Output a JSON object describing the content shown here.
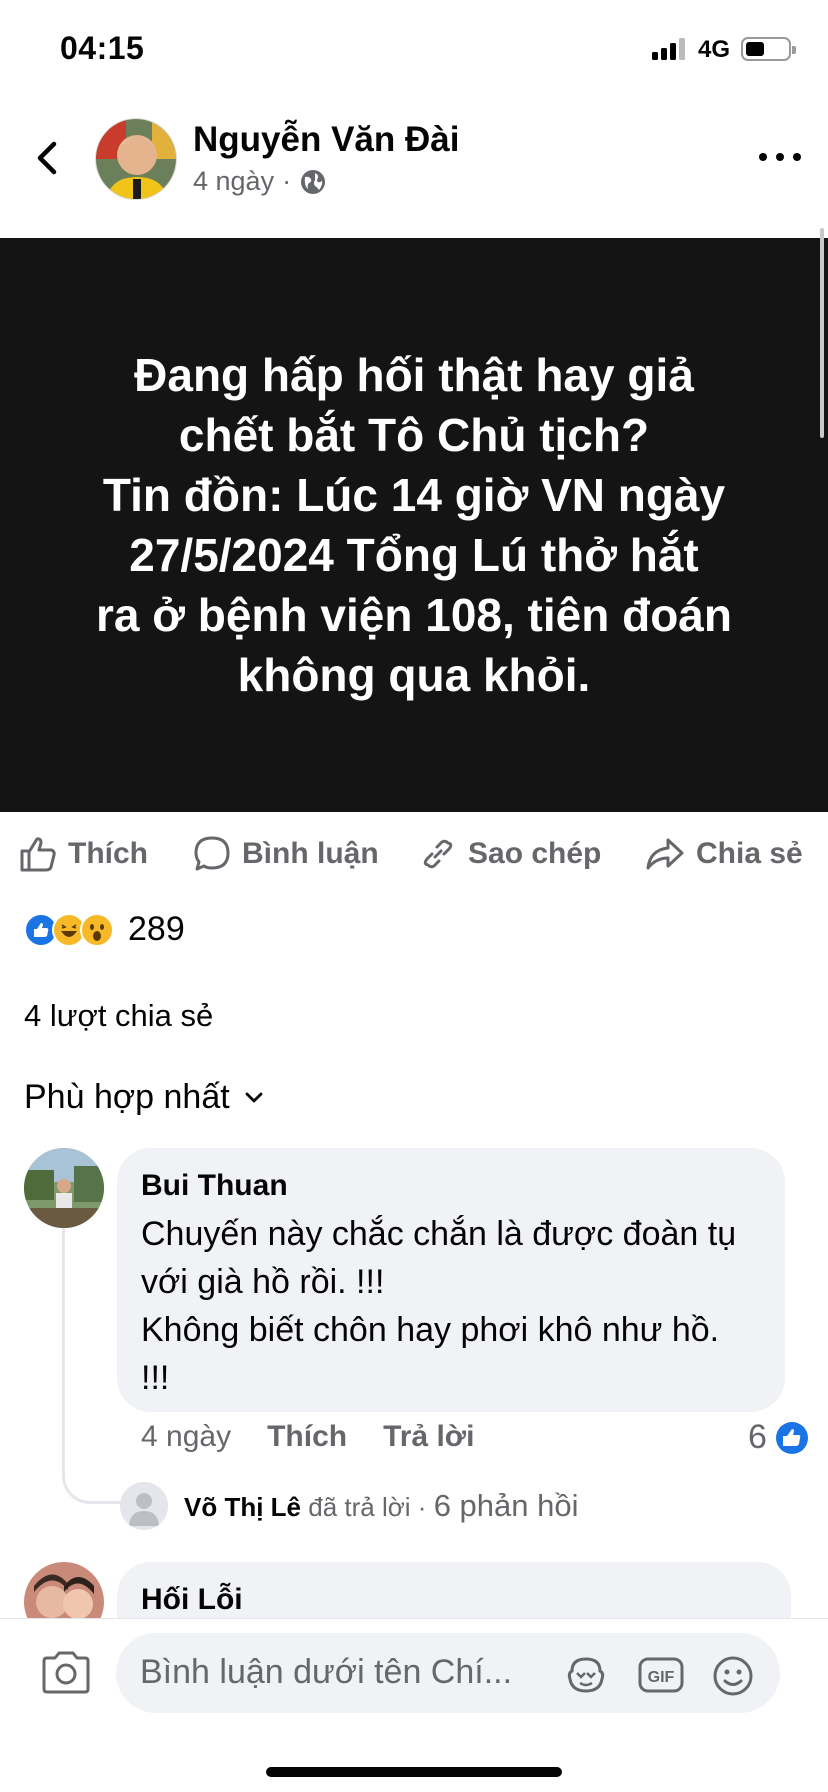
{
  "status_bar": {
    "time": "04:15",
    "network": "4G",
    "battery_level": 0.35
  },
  "post": {
    "author": "Nguyễn Văn Đài",
    "time_ago": "4 ngày",
    "separator": "·",
    "privacy_icon": "globe-icon",
    "body_text": "Đang hấp hối thật hay giả\nchết bắt Tô Chủ tịch?\nTin đồn: Lúc 14 giờ VN ngày\n27/5/2024 Tổng Lú thở hắt\nra ở bệnh viện 108, tiên đoán\nkhông qua khỏi.",
    "body_background": "#141414"
  },
  "actions": {
    "like": "Thích",
    "comment": "Bình luận",
    "copy": "Sao chép",
    "share": "Chia sẻ"
  },
  "reactions": {
    "icons": [
      "like-reaction-icon",
      "haha-reaction-icon",
      "wow-reaction-icon"
    ],
    "count": "289",
    "shares": "4 lượt chia sẻ"
  },
  "sort": {
    "label": "Phù hợp nhất"
  },
  "comments": [
    {
      "author": "Bui Thuan",
      "text": "Chuyến này chắc chắn là được đoàn tụ\nvới già hồ rồi.  !!!\nKhông biết chôn hay phơi khô như hồ.\n!!!",
      "time_ago": "4 ngày",
      "like_label": "Thích",
      "reply_label": "Trả lời",
      "like_count": "6",
      "reply_preview": {
        "name": "Võ Thị Lê",
        "action": "đã trả lời",
        "separator": "·",
        "count": "6 phản hồi"
      }
    },
    {
      "author": "Hối Lỗi"
    }
  ],
  "composer": {
    "placeholder": "Bình luận dưới tên Chí..."
  },
  "colors": {
    "accent": "#1b74e4",
    "muted_text": "#65676b",
    "bubble": "#f0f2f5"
  }
}
